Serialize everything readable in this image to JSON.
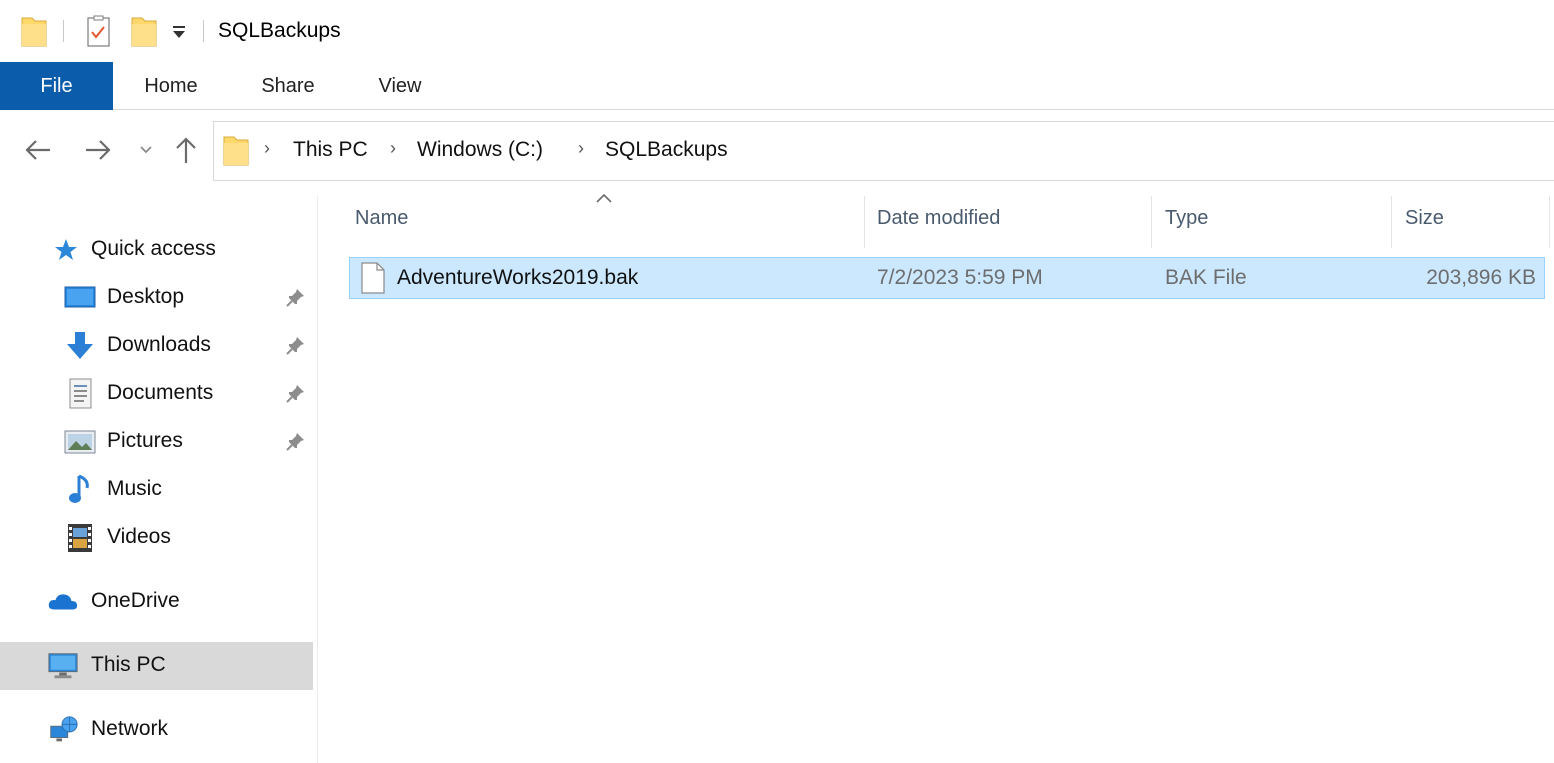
{
  "window": {
    "title": "SQLBackups"
  },
  "ribbon": {
    "tabs": [
      {
        "label": "File"
      },
      {
        "label": "Home"
      },
      {
        "label": "Share"
      },
      {
        "label": "View"
      }
    ]
  },
  "address": {
    "breadcrumbs": [
      "This PC",
      "Windows (C:)",
      "SQLBackups"
    ]
  },
  "navpane": {
    "quick_access": "Quick access",
    "items": [
      {
        "label": "Desktop",
        "icon": "desktop-icon",
        "pinned": true
      },
      {
        "label": "Downloads",
        "icon": "downloads-icon",
        "pinned": true
      },
      {
        "label": "Documents",
        "icon": "documents-icon",
        "pinned": true
      },
      {
        "label": "Pictures",
        "icon": "pictures-icon",
        "pinned": true
      },
      {
        "label": "Music",
        "icon": "music-icon",
        "pinned": false
      },
      {
        "label": "Videos",
        "icon": "videos-icon",
        "pinned": false
      }
    ],
    "onedrive": "OneDrive",
    "this_pc": "This PC",
    "network": "Network",
    "selected": "This PC"
  },
  "columns": {
    "name": "Name",
    "date": "Date modified",
    "type": "Type",
    "size": "Size",
    "sorted_by": "Name"
  },
  "files": [
    {
      "name": "AdventureWorks2019.bak",
      "date_modified": "7/2/2023 5:59 PM",
      "type": "BAK File",
      "size": "203,896 KB",
      "selected": true
    }
  ],
  "colors": {
    "file_tab": "#0b5cab",
    "selection_fill": "#cce8ff",
    "selection_border": "#99d1ff",
    "folder_yellow": "#ffd86b",
    "nav_selected": "#d9d9d9"
  }
}
